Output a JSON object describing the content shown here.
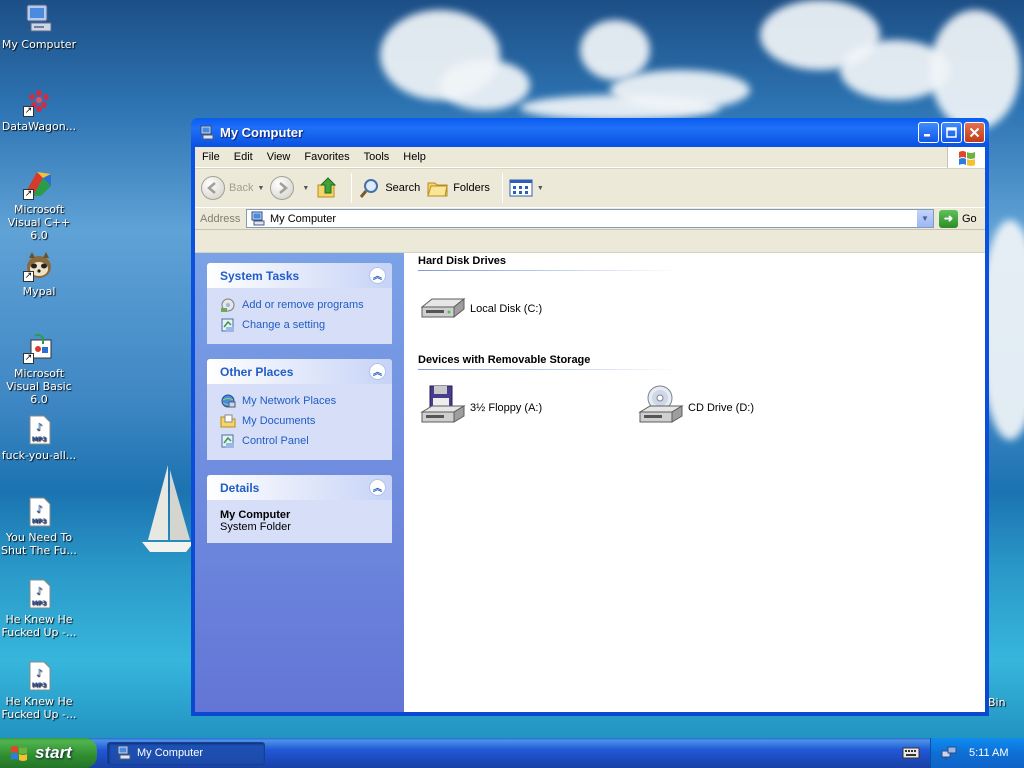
{
  "desktop": {
    "icons": [
      {
        "label": "My Computer",
        "icon": "my-computer-icon"
      },
      {
        "label": "DataWagon...",
        "icon": "datawagon-icon"
      },
      {
        "label": "Microsoft Visual C++ 6.0",
        "icon": "visual-cpp-icon"
      },
      {
        "label": "Mypal",
        "icon": "mypal-icon"
      },
      {
        "label": "Microsoft Visual Basic 6.0",
        "icon": "visual-basic-icon"
      },
      {
        "label": "fuck-you-all...",
        "icon": "mp3-file-icon"
      },
      {
        "label": "You Need To Shut The Fu...",
        "icon": "mp3-file-icon"
      },
      {
        "label": "He Knew He Fucked Up -...",
        "icon": "mp3-file-icon"
      },
      {
        "label": "He Knew He Fucked Up -...",
        "icon": "mp3-file-icon"
      }
    ],
    "mp3_badge": "MP3",
    "recycle_fragment": "Bin"
  },
  "window": {
    "title": "My Computer",
    "menu": [
      "File",
      "Edit",
      "View",
      "Favorites",
      "Tools",
      "Help"
    ],
    "toolbar": {
      "back": "Back",
      "search": "Search",
      "folders": "Folders"
    },
    "address": {
      "label": "Address",
      "value": "My Computer",
      "go": "Go"
    },
    "tasks": {
      "system_tasks": {
        "title": "System Tasks",
        "items": [
          "Add or remove programs",
          "Change a setting"
        ]
      },
      "other_places": {
        "title": "Other Places",
        "items": [
          "My Network Places",
          "My Documents",
          "Control Panel"
        ]
      },
      "details": {
        "title": "Details",
        "name": "My Computer",
        "subtitle": "System Folder"
      }
    },
    "content": {
      "hard_disk_group": "Hard Disk Drives",
      "removable_group": "Devices with Removable Storage",
      "local_disk": "Local Disk (C:)",
      "floppy": "3½ Floppy (A:)",
      "cd_drive": "CD Drive (D:)"
    }
  },
  "taskbar": {
    "start": "start",
    "task_button": "My Computer",
    "clock": "5:11 AM"
  },
  "colors": {
    "title_blue": "#0a5cf0",
    "task_link": "#215dc6",
    "start_green": "#3c9a3c"
  }
}
